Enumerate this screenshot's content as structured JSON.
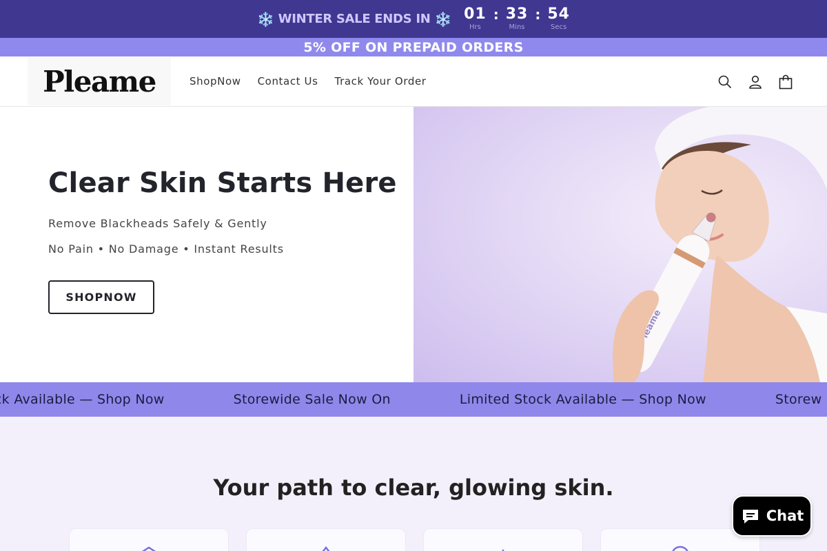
{
  "topbar": {
    "sale_text": "WINTER SALE ENDS IN",
    "flake": "❄️",
    "hours": "01",
    "hours_label": "Hrs",
    "minutes": "33",
    "minutes_label": "Mins",
    "seconds": "54",
    "seconds_label": "Secs",
    "separator": ":"
  },
  "promo": {
    "text": "5% OFF ON PREPAID ORDERS"
  },
  "header": {
    "logo": "Pleame",
    "nav": [
      "ShopNow",
      "Contact Us",
      "Track Your Order"
    ],
    "icons": [
      "search-icon",
      "account-icon",
      "cart-icon"
    ]
  },
  "hero": {
    "title": "Clear Skin Starts Here",
    "subtitle1": "Remove Blackheads Safely & Gently",
    "subtitle2": "No Pain • No Damage • Instant Results",
    "button": "SHOPNOW",
    "image_brand": "Pleame"
  },
  "marquee": {
    "items": [
      "ock Available — Shop Now",
      "Storewide Sale Now On",
      "Limited Stock Available — Shop Now",
      "Storew"
    ]
  },
  "section": {
    "title": "Your path to clear, glowing skin."
  },
  "chat": {
    "label": "Chat"
  },
  "colors": {
    "topbar": "#3f3790",
    "accent": "#9089ed",
    "marquee": "#9087eb",
    "chat": "#000000"
  }
}
